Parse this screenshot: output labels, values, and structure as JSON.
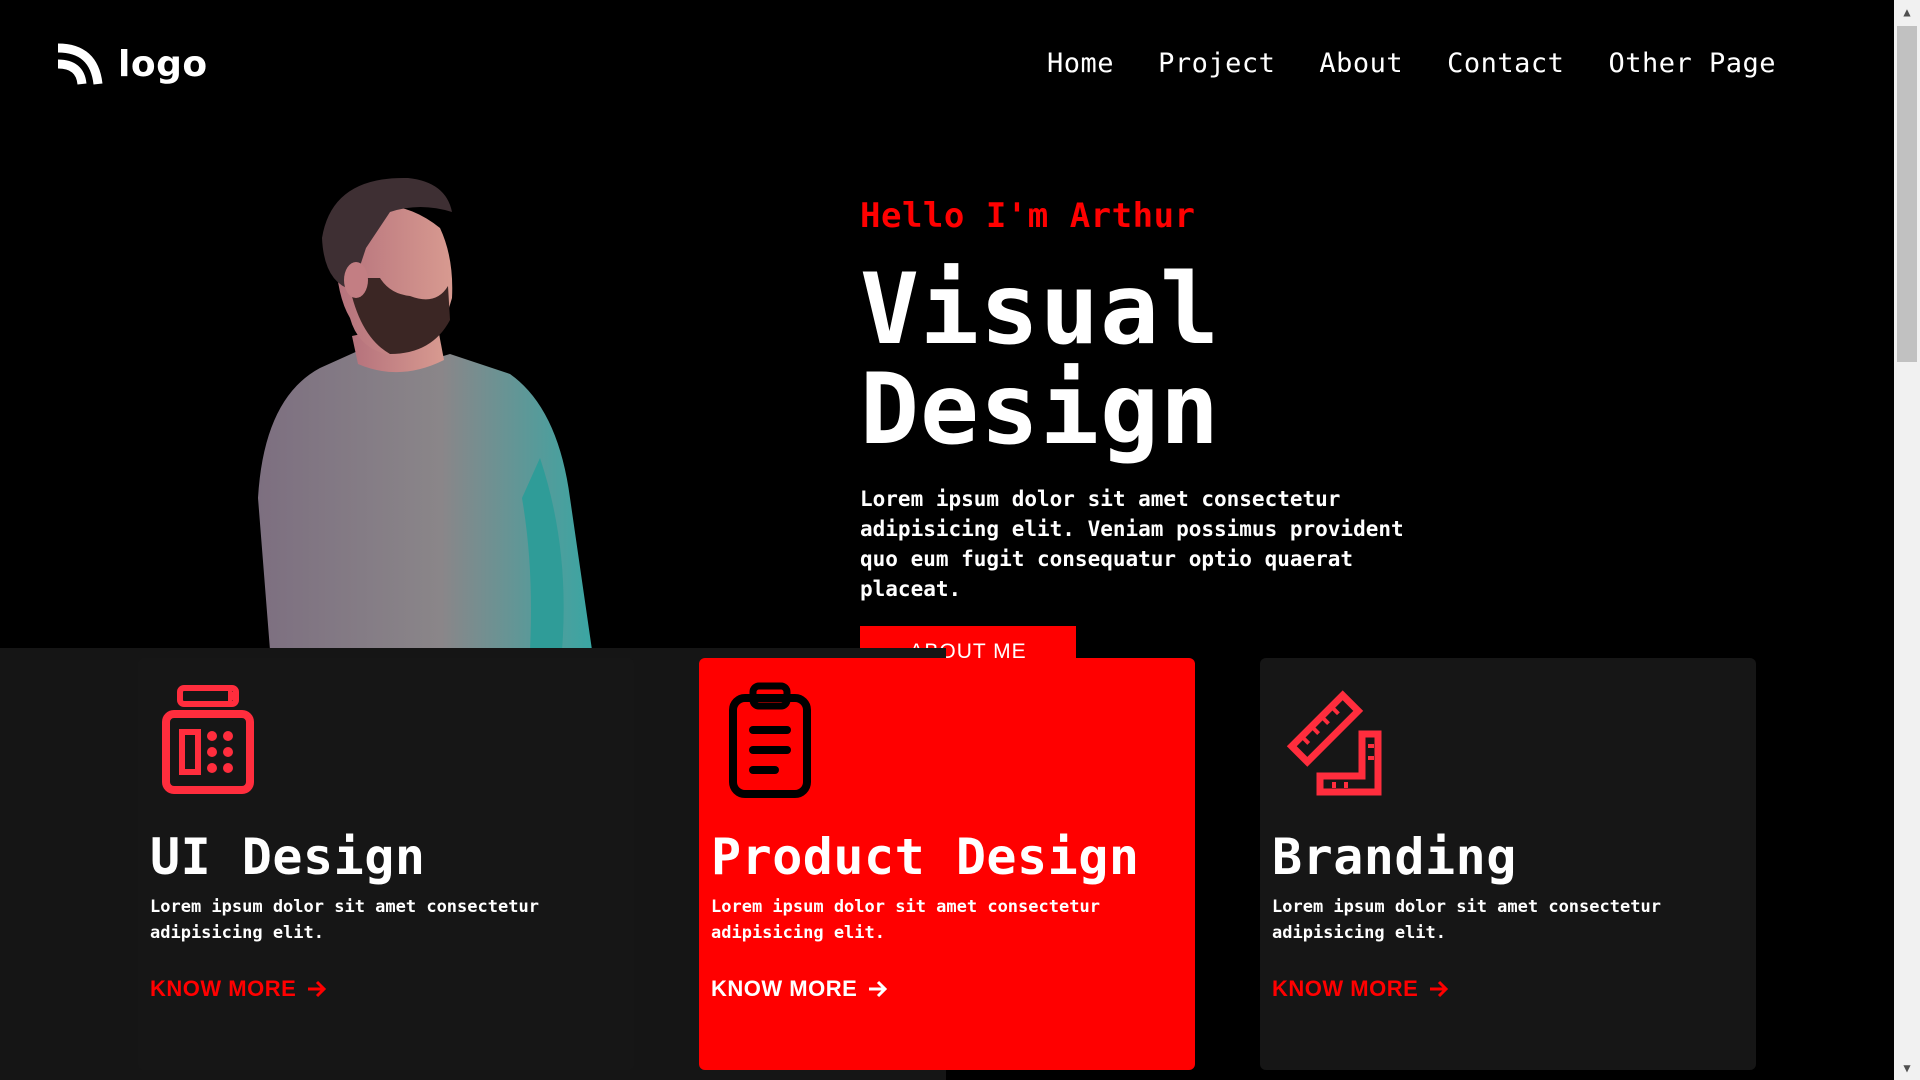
{
  "header": {
    "logo_text": "logo",
    "nav": [
      "Home",
      "Project",
      "About",
      "Contact",
      "Other Page"
    ]
  },
  "hero": {
    "greeting": "Hello I'm Arthur",
    "title": "Visual Design",
    "description": "Lorem ipsum dolor sit amet consectetur adipisicing elit. Veniam possimus provident quo eum fugit consequatur optio quaerat placeat.",
    "button_label": "ABOUT ME"
  },
  "cards": [
    {
      "icon": "calculator-icon",
      "title": "UI Design",
      "description": "Lorem ipsum dolor sit amet consectetur adipisicing elit.",
      "link_label": "KNOW MORE"
    },
    {
      "icon": "clipboard-icon",
      "title": "Product Design",
      "description": "Lorem ipsum dolor sit amet consectetur adipisicing elit.",
      "link_label": "KNOW MORE",
      "active": true
    },
    {
      "icon": "ruler-icon",
      "title": "Branding",
      "description": "Lorem ipsum dolor sit amet consectetur adipisicing elit.",
      "link_label": "KNOW MORE"
    }
  ],
  "colors": {
    "accent": "#ff0000",
    "background": "#000000",
    "card": "#161616",
    "text": "#ffffff"
  }
}
